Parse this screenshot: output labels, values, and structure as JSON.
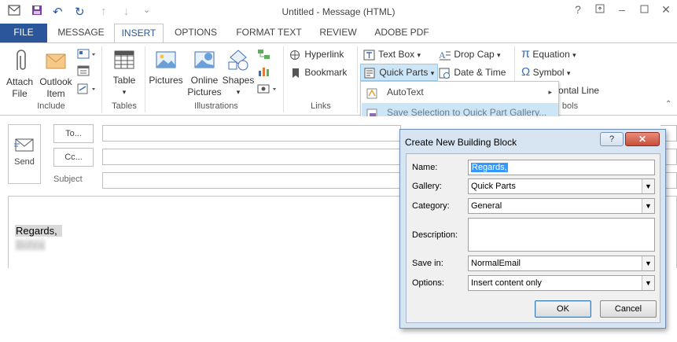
{
  "titlebar": {
    "title": "Untitled - Message (HTML)",
    "controls": [
      "?",
      "restore",
      "minimize",
      "maximize",
      "close"
    ]
  },
  "tabs": [
    "FILE",
    "MESSAGE",
    "INSERT",
    "OPTIONS",
    "FORMAT TEXT",
    "REVIEW",
    "ADOBE PDF"
  ],
  "active_tab": "INSERT",
  "ribbon": {
    "include": {
      "attach_file": "Attach\nFile",
      "attach_l1": "Attach",
      "attach_l2": "File",
      "outlook_l1": "Outlook",
      "outlook_l2": "Item",
      "label": "Include"
    },
    "tables": {
      "table": "Table",
      "label": "Tables"
    },
    "illustrations": {
      "pictures": "Pictures",
      "online_l1": "Online",
      "online_l2": "Pictures",
      "shapes": "Shapes",
      "label": "Illustrations"
    },
    "links": {
      "hyperlink": "Hyperlink",
      "bookmark": "Bookmark",
      "label": "Links"
    },
    "text": {
      "text_box": "Text Box",
      "quick_parts": "Quick Parts",
      "drop_cap": "Drop Cap",
      "date_time": "Date & Time",
      "horizontal_line_partial": "ontal Line"
    },
    "symbols": {
      "equation": "Equation",
      "symbol": "Symbol",
      "label_partial": "bols"
    }
  },
  "quick_parts_menu": {
    "items": [
      "AutoText",
      "Save Selection to Quick Part Gallery..."
    ]
  },
  "header": {
    "send": "Send",
    "to": "To...",
    "cc": "Cc...",
    "subject": "Subject"
  },
  "body": {
    "line1": "Regards,",
    "line2": "Bohra"
  },
  "dialog": {
    "title": "Create New Building Block",
    "help": "?",
    "labels": {
      "name": "Name:",
      "gallery": "Gallery:",
      "category": "Category:",
      "description": "Description:",
      "save_in": "Save in:",
      "options": "Options:"
    },
    "values": {
      "name": "Regards,",
      "gallery": "Quick Parts",
      "category": "General",
      "description": "",
      "save_in": "NormalEmail",
      "options": "Insert content only"
    },
    "ok": "OK",
    "cancel": "Cancel"
  }
}
